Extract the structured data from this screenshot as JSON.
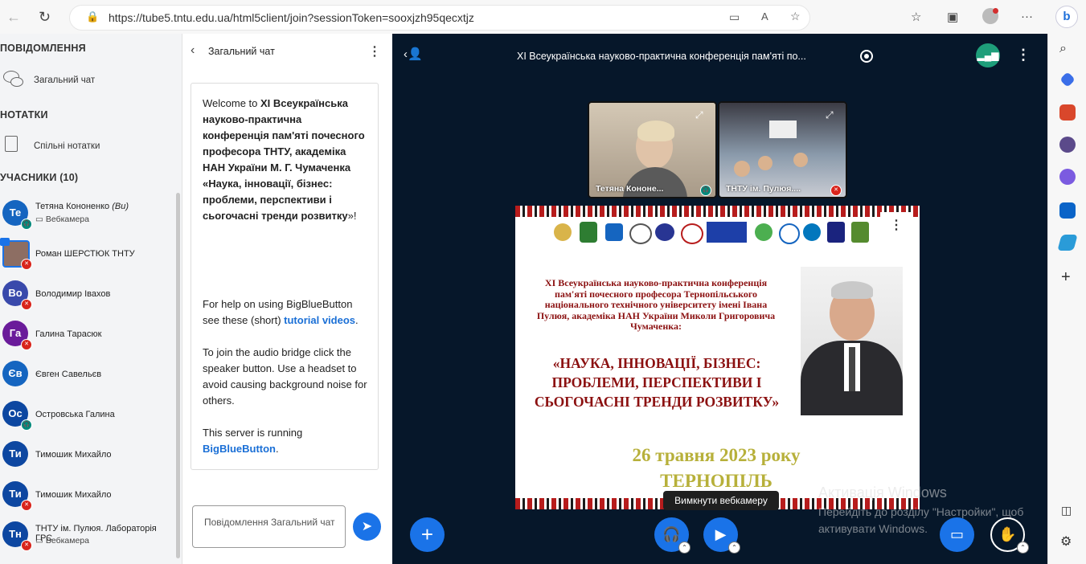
{
  "browser": {
    "url": "https://tube5.tntu.edu.ua/html5client/join?sessionToken=sooxjzh95qecxtjz"
  },
  "users_panel": {
    "messages_title": "ПОВІДОМЛЕННЯ",
    "public_chat": "Загальний чат",
    "notes_title": "НОТАТКИ",
    "shared_notes": "Спільні нотатки",
    "participants_title": "УЧАСНИКИ (10)",
    "users": [
      {
        "initials": "Те",
        "name": "Тетяна Кононенко",
        "you": "(Ви)",
        "sub": "▭ Вебкамера",
        "color": "#1565c0",
        "mic": "on"
      },
      {
        "initials": "",
        "name": "Роман ШЕРСТЮК ТНТУ",
        "you": "",
        "sub": "",
        "color": "#6d6d6d",
        "mic": "off"
      },
      {
        "initials": "Во",
        "name": "Володимир Івахов",
        "you": "",
        "sub": "",
        "color": "#3949ab",
        "mic": "off"
      },
      {
        "initials": "Га",
        "name": "Галина Тарасюк",
        "you": "",
        "sub": "",
        "color": "#6a1b9a",
        "mic": "off"
      },
      {
        "initials": "Єв",
        "name": "Євген Савельєв",
        "you": "",
        "sub": "",
        "color": "#1565c0",
        "mic": ""
      },
      {
        "initials": "Ос",
        "name": "Островська Галина",
        "you": "",
        "sub": "",
        "color": "#0d47a1",
        "mic": "on"
      },
      {
        "initials": "Ти",
        "name": "Тимошик Михайло",
        "you": "",
        "sub": "",
        "color": "#0d47a1",
        "mic": ""
      },
      {
        "initials": "Ти",
        "name": "Тимошик Михайло",
        "you": "",
        "sub": "",
        "color": "#0d47a1",
        "mic": "off"
      },
      {
        "initials": "Тн",
        "name": "ТНТУ ім. Пулюя. Лабораторія ГРС",
        "you": "",
        "sub": "▭ Вебкамера",
        "color": "#0d47a1",
        "mic": "off"
      }
    ]
  },
  "chat": {
    "title": "Загальний чат",
    "welcome_prefix": "Welcome to ",
    "welcome_bold": "XI Всеукраїнська науково-практична конференція пам'яті почесного професора ТНТУ, академіка НАН України М. Г. Чумаченка «Наука, інновації, бізнес: проблеми, перспективи і сьогочасні тренди розвитку",
    "welcome_suffix": "»!",
    "help_text": "For help on using BigBlueButton see these (short) ",
    "help_link": "tutorial videos",
    "help_end": ".",
    "audio_text": "To join the audio bridge click the speaker button. Use a headset to avoid causing background noise for others.",
    "server_text": "This server is running ",
    "server_link": "BigBlueButton",
    "server_end": ".",
    "input_placeholder": "Повідомлення Загальний чат"
  },
  "main": {
    "title": "XI Всеукраїнська науково-практична конференція пам'яті по...",
    "videos": [
      {
        "label": "Тетяна Кононе..."
      },
      {
        "label": "ТНТУ ім. Пулюя...."
      }
    ],
    "slide": {
      "heading": "XI Всеукраїнська науково-практична конференція пам'яті почесного професора Тернопільського національного технічного університету імені Івана Пулюя, академіка НАН України Миколи Григоровича Чумаченка:",
      "theme": "«НАУКА, ІННОВАЦІЇ, БІЗНЕС: ПРОБЛЕМИ, ПЕРСПЕКТИВИ І СЬОГОЧАСНІ ТРЕНДИ РОЗВИТКУ»",
      "date": "26 травня 2023 року",
      "city": "ТЕРНОПІЛЬ"
    },
    "tooltip": "Вимкнути вебкамеру",
    "activation_title": "Активація Windows",
    "activation_sub": "Перейдіть до розділу \"Настройки\", щоб активувати Windows."
  }
}
